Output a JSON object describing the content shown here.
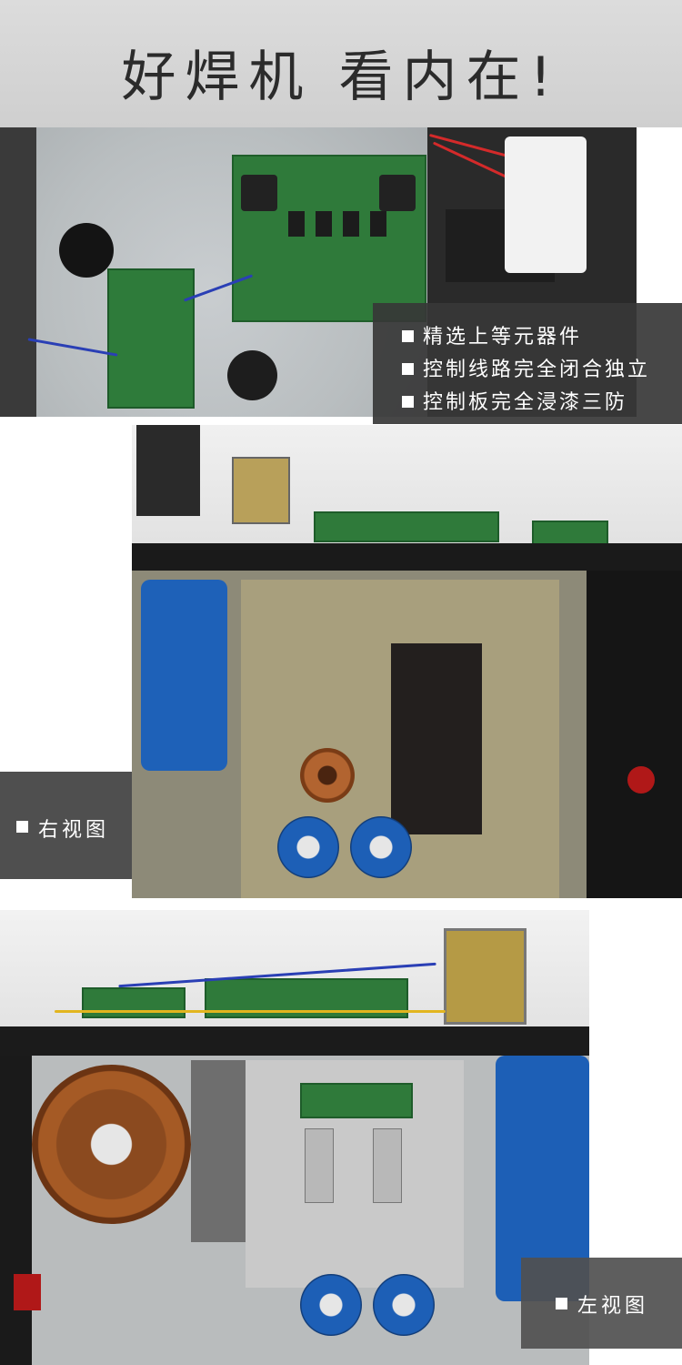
{
  "header": {
    "title": "好焊机 看内在!"
  },
  "features": {
    "items": [
      "精选上等元器件",
      "控制线路完全闭合独立",
      "控制板完全浸漆三防"
    ]
  },
  "views": {
    "right_label": "右视图",
    "left_label": "左视图"
  },
  "colors": {
    "header_bg": "#d4d4d4",
    "overlay_bg": "#373737",
    "pcb_green": "#2f7a3a",
    "capacitor_blue": "#1e61b8",
    "copper": "#a55a25"
  }
}
